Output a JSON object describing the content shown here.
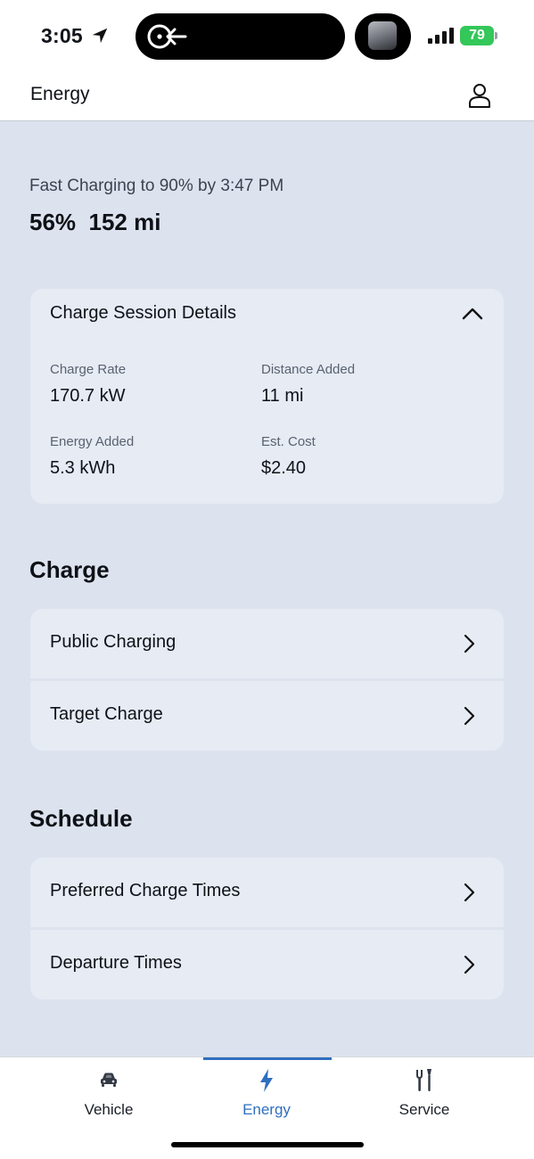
{
  "status_bar": {
    "time": "3:05",
    "battery": "79",
    "icons": [
      "location-arrow-icon",
      "screen-mirroring-icon",
      "album-art",
      "signal-icon",
      "battery-icon"
    ]
  },
  "header": {
    "title": "Energy",
    "profile_icon": "person-icon"
  },
  "charging": {
    "status": "Fast Charging to 90% by 3:47 PM",
    "level": "56%  152 mi"
  },
  "session": {
    "title": "Charge Session Details",
    "toggle_icon": "chevron-up-icon",
    "details": [
      {
        "label": "Charge Rate",
        "value": "170.7 kW"
      },
      {
        "label": "Distance Added",
        "value": "11 mi"
      },
      {
        "label": "Energy Added",
        "value": "5.3 kWh"
      },
      {
        "label": "Est. Cost",
        "value": "$2.40"
      }
    ]
  },
  "charge_section": {
    "heading": "Charge",
    "items": [
      {
        "label": "Public Charging",
        "icon": "chevron-right-icon"
      },
      {
        "label": "Target Charge",
        "icon": "chevron-right-icon"
      }
    ]
  },
  "schedule_section": {
    "heading": "Schedule",
    "items": [
      {
        "label": "Preferred Charge Times",
        "icon": "chevron-right-icon"
      },
      {
        "label": "Departure Times",
        "icon": "chevron-right-icon"
      }
    ]
  },
  "tabs": [
    {
      "label": "Vehicle",
      "icon": "car-icon",
      "active": false
    },
    {
      "label": "Energy",
      "icon": "lightning-bolt-icon",
      "active": true
    },
    {
      "label": "Service",
      "icon": "tools-icon",
      "active": false
    }
  ],
  "colors": {
    "background": "#dde3ee",
    "card": "#e6ebf4",
    "accent": "#2f6fbf",
    "battery": "#34c759"
  }
}
